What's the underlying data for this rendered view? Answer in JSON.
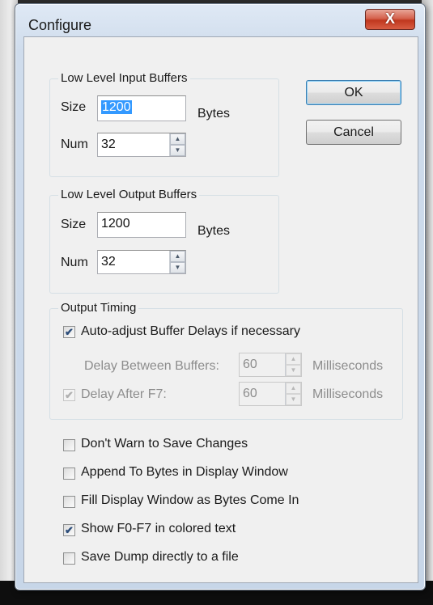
{
  "window": {
    "title": "Configure",
    "close_glyph": "X"
  },
  "input_buffers": {
    "legend": "Low Level Input Buffers",
    "size_label": "Size",
    "size_value": "1200",
    "size_unit": "Bytes",
    "num_label": "Num",
    "num_value": "32"
  },
  "output_buffers": {
    "legend": "Low Level Output Buffers",
    "size_label": "Size",
    "size_value": "1200",
    "size_unit": "Bytes",
    "num_label": "Num",
    "num_value": "32"
  },
  "buttons": {
    "ok": "OK",
    "cancel": "Cancel"
  },
  "output_timing": {
    "legend": "Output Timing",
    "auto_adjust_label": "Auto-adjust Buffer Delays if necessary",
    "auto_adjust_checked": true,
    "delay_between_label": "Delay Between Buffers:",
    "delay_between_value": "60",
    "delay_between_unit": "Milliseconds",
    "delay_after_label": "Delay After F7:",
    "delay_after_checked": true,
    "delay_after_value": "60",
    "delay_after_unit": "Milliseconds"
  },
  "options": [
    {
      "label": "Don't Warn to Save Changes",
      "checked": false
    },
    {
      "label": "Append To Bytes in Display Window",
      "checked": false
    },
    {
      "label": "Fill Display Window as Bytes Come In",
      "checked": false
    },
    {
      "label": "Show F0-F7 in colored text",
      "checked": true
    },
    {
      "label": "Save Dump directly to a file",
      "checked": false
    }
  ],
  "check_glyph": "✔",
  "spin_up_glyph": "▲",
  "spin_down_glyph": "▼"
}
